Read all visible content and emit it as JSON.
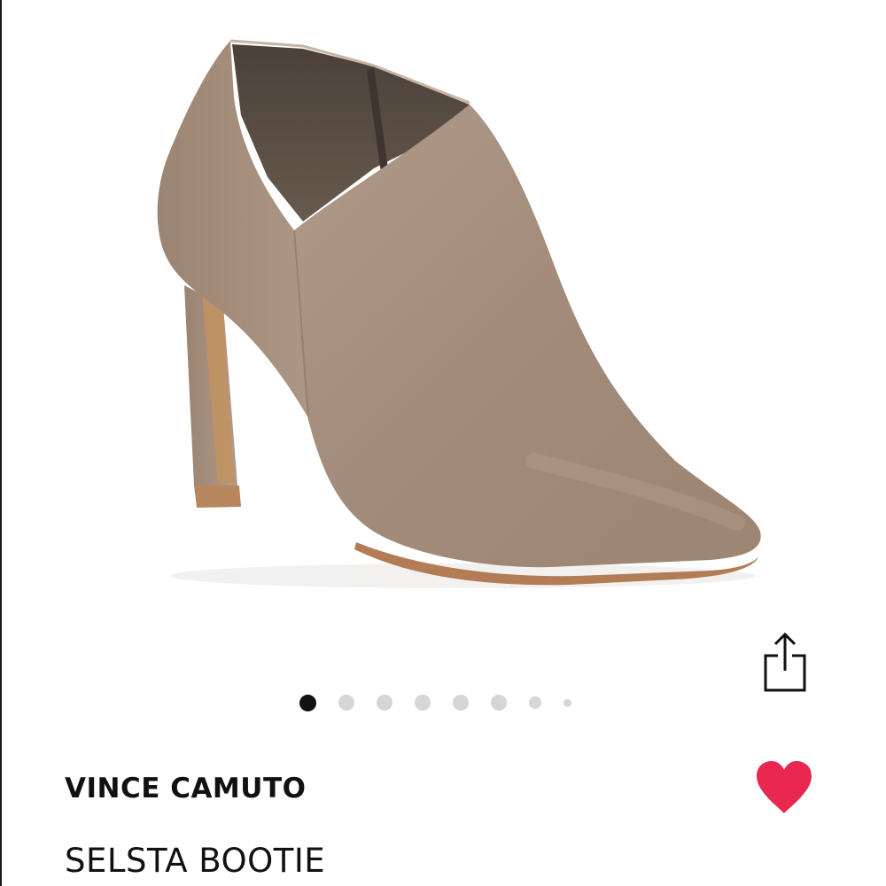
{
  "product": {
    "brand": "VINCE CAMUTO",
    "name": "SELSTA BOOTIE"
  },
  "gallery": {
    "image_count": 8,
    "active_index": 0
  },
  "icons": {
    "share": "share-icon",
    "favorite": "heart-icon"
  },
  "colors": {
    "favorite": "#e8284f",
    "active_dot": "#111111",
    "inactive_dot": "#d6d6d6",
    "suede": "#a68f7e",
    "sole": "#b27d55"
  }
}
